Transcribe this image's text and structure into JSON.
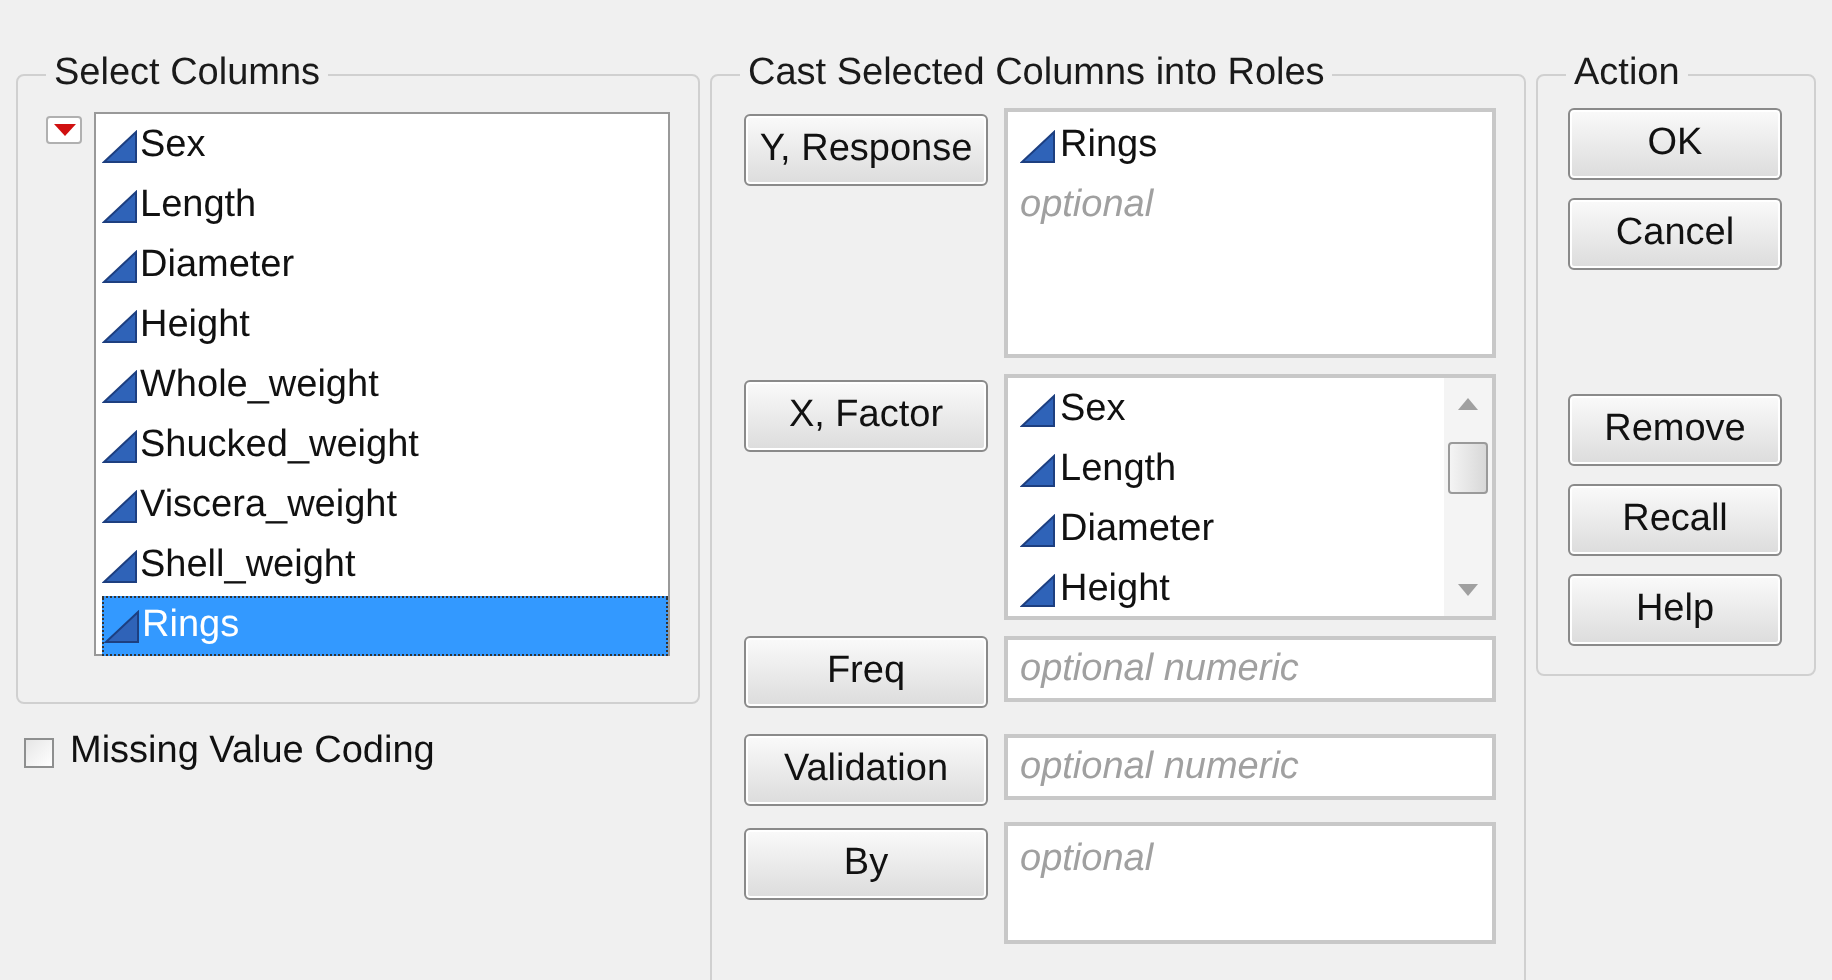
{
  "select_columns": {
    "title": "Select Columns",
    "columns": [
      {
        "name": "Sex",
        "selected": false
      },
      {
        "name": "Length",
        "selected": false
      },
      {
        "name": "Diameter",
        "selected": false
      },
      {
        "name": "Height",
        "selected": false
      },
      {
        "name": "Whole_weight",
        "selected": false
      },
      {
        "name": "Shucked_weight",
        "selected": false
      },
      {
        "name": "Viscera_weight",
        "selected": false
      },
      {
        "name": "Shell_weight",
        "selected": false
      },
      {
        "name": "Rings",
        "selected": true
      }
    ]
  },
  "missing_value_coding": {
    "label": "Missing Value Coding",
    "checked": false
  },
  "cast_roles": {
    "title": "Cast Selected Columns into Roles",
    "roles": [
      {
        "button": "Y, Response",
        "kind": "list",
        "items": [
          "Rings"
        ],
        "placeholder": "optional"
      },
      {
        "button": "X, Factor",
        "kind": "scroll_list",
        "items": [
          "Sex",
          "Length",
          "Diameter",
          "Height"
        ]
      },
      {
        "button": "Freq",
        "kind": "field",
        "placeholder": "optional numeric"
      },
      {
        "button": "Validation",
        "kind": "field",
        "placeholder": "optional numeric"
      },
      {
        "button": "By",
        "kind": "list",
        "placeholder": "optional"
      }
    ]
  },
  "action": {
    "title": "Action",
    "primary": [
      "OK",
      "Cancel"
    ],
    "secondary": [
      "Remove",
      "Recall",
      "Help"
    ]
  }
}
